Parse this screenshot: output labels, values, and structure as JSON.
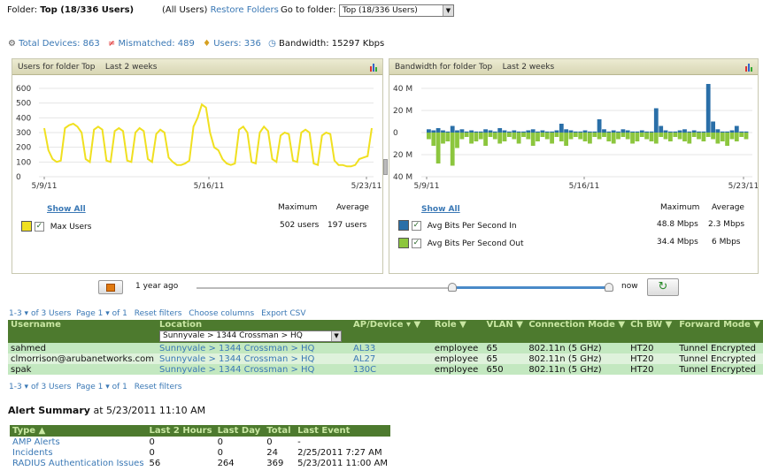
{
  "header": {
    "folder_label": "Folder:",
    "folder_name": "Top (18/336 Users)",
    "all_users": "(All Users)",
    "restore_folders": "Restore Folders",
    "goto_label": "Go to folder:",
    "goto_value": "Top (18/336 Users)"
  },
  "stats": {
    "total_devices": "Total Devices: 863",
    "mismatched": "Mismatched: 489",
    "users": "Users: 336",
    "bandwidth": "Bandwidth: 15297 Kbps"
  },
  "users_chart": {
    "title": "Users for folder Top    Last 2 weeks",
    "show_all": "Show All",
    "col_max": "Maximum",
    "col_avg": "Average",
    "series_label": "Max Users",
    "series_max": "502 users",
    "series_avg": "197 users",
    "color": "#f0e020"
  },
  "bw_chart": {
    "title": "Bandwidth for folder Top    Last 2 weeks",
    "show_all": "Show All",
    "col_max": "Maximum",
    "col_avg": "Average",
    "in_label": "Avg Bits Per Second In",
    "in_max": "48.8 Mbps",
    "in_avg": "2.3 Mbps",
    "out_label": "Avg Bits Per Second Out",
    "out_max": "34.4 Mbps",
    "out_avg": "6 Mbps",
    "in_color": "#2a6fa8",
    "out_color": "#8cc63e"
  },
  "chart_data": [
    {
      "type": "line",
      "ylim": [
        0,
        600
      ],
      "yticks": [
        "600",
        "500",
        "400",
        "300",
        "200",
        "100",
        "0"
      ],
      "xticks": [
        "5/9/11",
        "5/16/11",
        "5/23/11"
      ],
      "series": [
        {
          "name": "Max Users",
          "values": [
            330,
            180,
            120,
            100,
            110,
            330,
            350,
            360,
            340,
            300,
            120,
            100,
            320,
            340,
            320,
            110,
            100,
            310,
            330,
            310,
            110,
            100,
            300,
            330,
            310,
            120,
            100,
            290,
            320,
            300,
            130,
            100,
            80,
            80,
            90,
            110,
            340,
            400,
            490,
            470,
            300,
            200,
            180,
            120,
            90,
            80,
            90,
            320,
            340,
            300,
            100,
            90,
            300,
            340,
            310,
            120,
            100,
            280,
            300,
            290,
            110,
            100,
            300,
            320,
            300,
            90,
            80,
            280,
            300,
            290,
            110,
            80,
            80,
            70,
            70,
            80,
            120,
            130,
            140,
            330
          ]
        }
      ]
    },
    {
      "type": "bar",
      "ylim": [
        -40,
        40
      ],
      "yticks": [
        "40 M",
        "20 M",
        "0",
        "20 M",
        "40 M"
      ],
      "xticks": [
        "5/9/11",
        "5/16/11",
        "5/23/11"
      ],
      "series": [
        {
          "name": "Avg Bits Per Second In",
          "values": [
            3,
            2,
            4,
            2,
            1,
            6,
            2,
            3,
            1,
            2,
            1,
            1,
            3,
            2,
            1,
            4,
            2,
            1,
            2,
            1,
            1,
            2,
            3,
            1,
            2,
            1,
            1,
            2,
            8,
            3,
            2,
            1,
            1,
            2,
            1,
            1,
            12,
            3,
            1,
            2,
            1,
            3,
            2,
            1,
            1,
            2,
            1,
            1,
            22,
            6,
            2,
            1,
            1,
            2,
            3,
            1,
            2,
            1,
            1,
            44,
            10,
            3,
            1,
            1,
            2,
            6,
            1,
            1
          ]
        },
        {
          "name": "Avg Bits Per Second Out",
          "values": [
            -6,
            -12,
            -28,
            -10,
            -8,
            -30,
            -14,
            -6,
            -4,
            -10,
            -8,
            -6,
            -12,
            -4,
            -6,
            -10,
            -8,
            -4,
            -6,
            -10,
            -4,
            -6,
            -12,
            -8,
            -4,
            -6,
            -10,
            -4,
            -8,
            -12,
            -6,
            -4,
            -6,
            -8,
            -10,
            -4,
            -6,
            -4,
            -8,
            -10,
            -6,
            -4,
            -6,
            -10,
            -8,
            -4,
            -6,
            -8,
            -10,
            -4,
            -6,
            -8,
            -4,
            -6,
            -8,
            -10,
            -4,
            -6,
            -8,
            -4,
            -6,
            -10,
            -8,
            -12,
            -6,
            -8,
            -4,
            -6
          ]
        }
      ]
    }
  ],
  "slider": {
    "left_label": "1 year ago",
    "right_label": "now"
  },
  "users_table": {
    "pager_top": "1-3 ▾ of 3 Users  Page 1 ▾ of 1",
    "reset_filters": "Reset filters",
    "choose_columns": "Choose columns",
    "export_csv": "Export CSV",
    "location_filter": "Sunnyvale > 1344 Crossman > HQ",
    "pager_bottom": "1-3 ▾ of 3 Users  Page 1 ▾ of 1",
    "columns": [
      "Username",
      "Location",
      "AP/Device ▾ ▼",
      "Role ▼",
      "VLAN ▼",
      "Connection Mode ▼",
      "Ch BW ▼",
      "Forward Mode ▼"
    ],
    "rows": [
      [
        "sahmed",
        "Sunnyvale > 1344 Crossman > HQ",
        "AL33",
        "employee",
        "65",
        "802.11n (5 GHz)",
        "HT20",
        "Tunnel Encrypted"
      ],
      [
        "clmorrison@arubanetworks.com",
        "Sunnyvale > 1344 Crossman > HQ",
        "AL27",
        "employee",
        "65",
        "802.11n (5 GHz)",
        "HT20",
        "Tunnel Encrypted"
      ],
      [
        "spak",
        "Sunnyvale > 1344 Crossman > HQ",
        "130C",
        "employee",
        "650",
        "802.11n (5 GHz)",
        "HT20",
        "Tunnel Encrypted"
      ]
    ]
  },
  "alerts": {
    "title": "Alert Summary",
    "title_suffix": "at 5/23/2011 11:10 AM",
    "columns": [
      "Type ▲",
      "Last 2 Hours",
      "Last Day",
      "Total",
      "Last Event"
    ],
    "rows": [
      [
        "AMP Alerts",
        "0",
        "0",
        "0",
        "-"
      ],
      [
        "Incidents",
        "0",
        "0",
        "24",
        "2/25/2011 7:27 AM"
      ],
      [
        "RADIUS Authentication Issues",
        "56",
        "264",
        "369",
        "5/23/2011 11:00 AM"
      ]
    ]
  }
}
